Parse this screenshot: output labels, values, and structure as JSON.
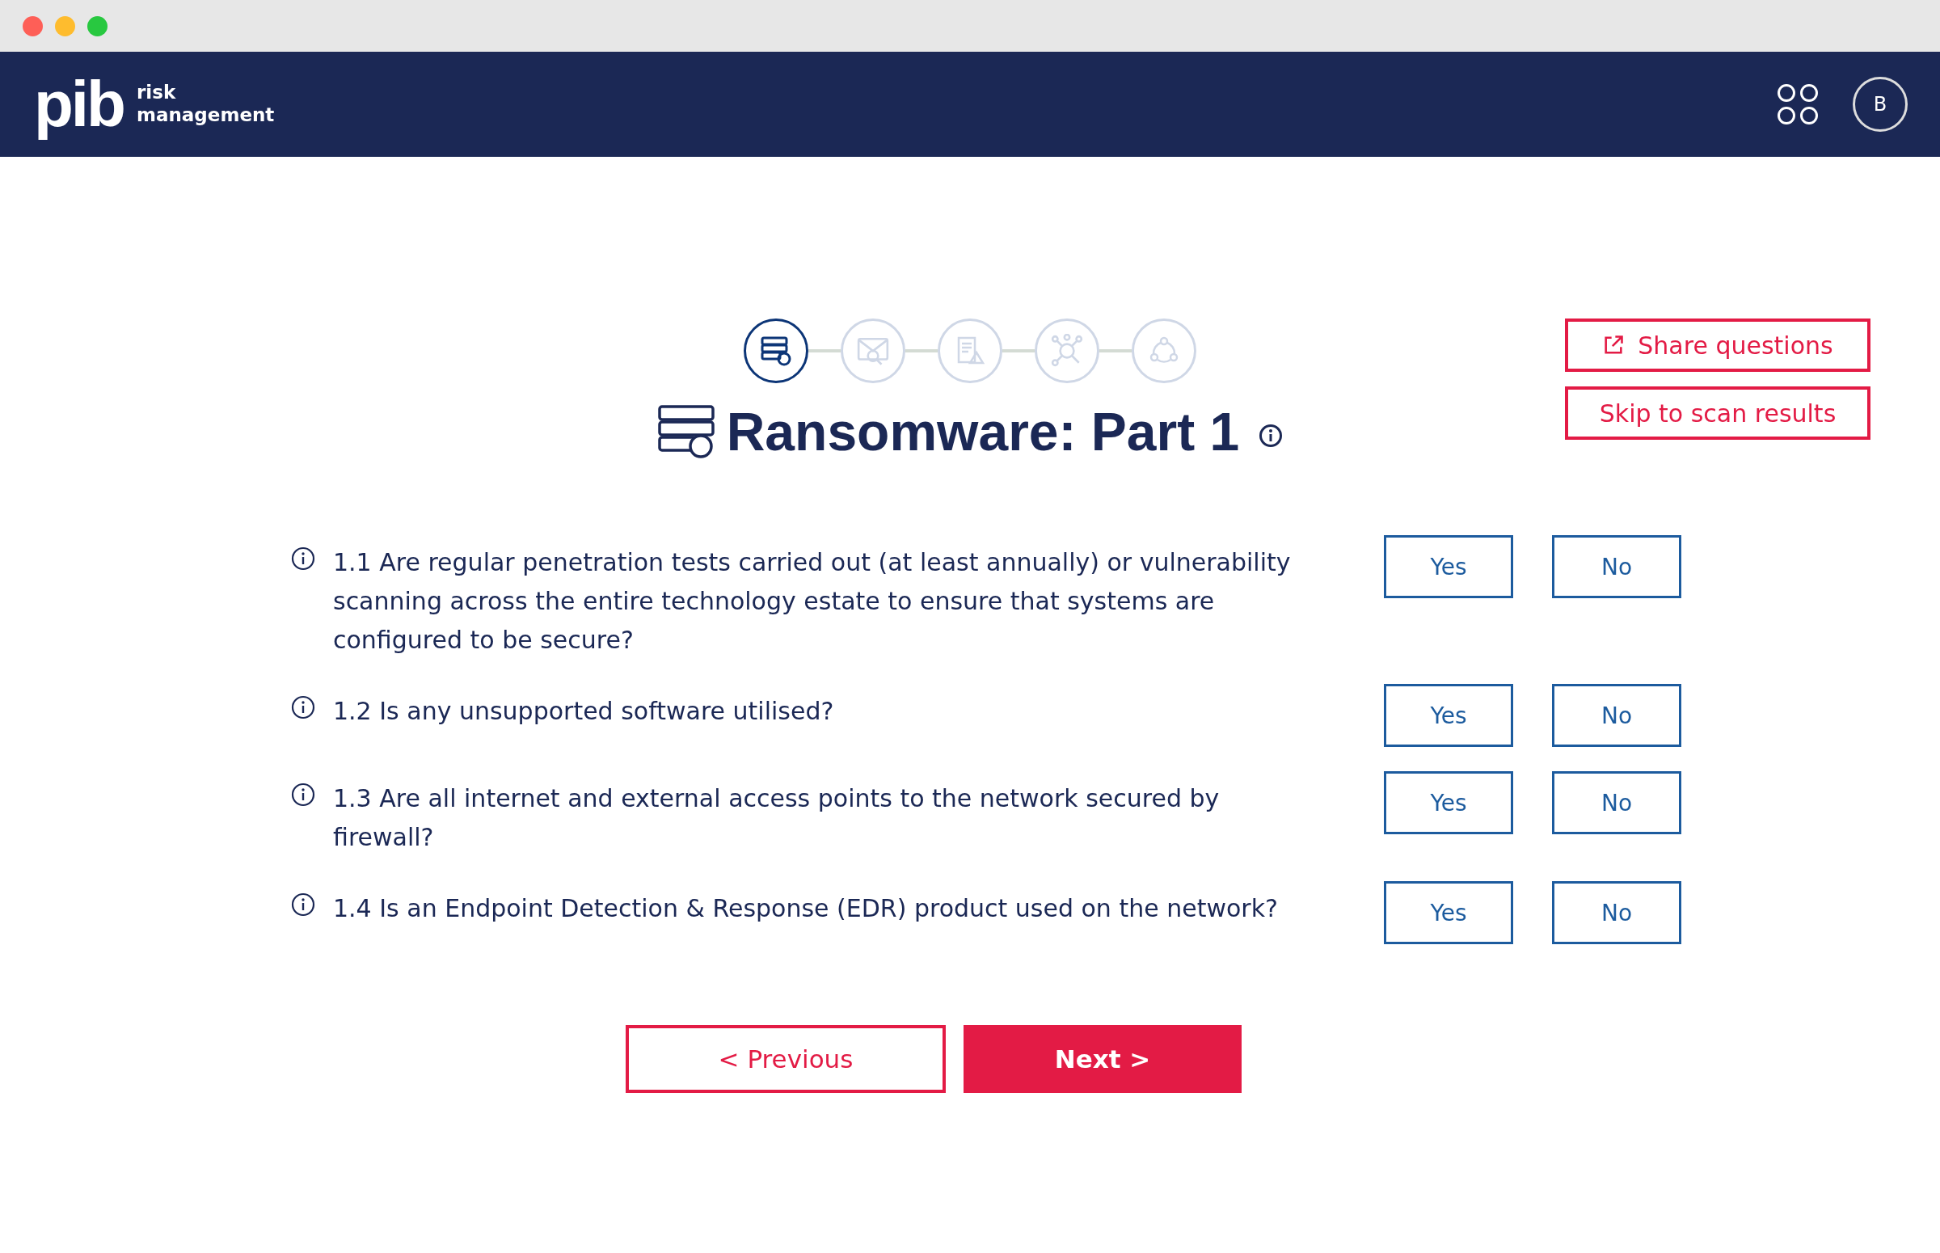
{
  "header": {
    "logo": "pib",
    "logo_subtitle_1": "risk",
    "logo_subtitle_2": "management",
    "avatar": "B"
  },
  "steps": [
    {
      "kind": "server",
      "selected": true
    },
    {
      "kind": "mail",
      "selected": false
    },
    {
      "kind": "document",
      "selected": false
    },
    {
      "kind": "network",
      "selected": false
    },
    {
      "kind": "cycle",
      "selected": false
    }
  ],
  "title": "Ransomware: Part 1",
  "actions": [
    {
      "kind": "share",
      "label": "Share questions"
    },
    {
      "kind": "plain",
      "label": "Skip to scan results"
    }
  ],
  "questions": [
    {
      "text": "1.1 Are regular penetration tests carried out (at least annually) or vulnerability scanning across the entire technology estate to ensure that systems are configured to be secure?",
      "answers": [
        "Yes",
        "No"
      ]
    },
    {
      "text": "1.2 Is any unsupported software utilised?",
      "answers": [
        "Yes",
        "No"
      ]
    },
    {
      "text": "1.3 Are all internet and external access points to the network secured by firewall?",
      "answers": [
        "Yes",
        "No"
      ]
    },
    {
      "text": "1.4 Is an Endpoint Detection & Response (EDR) product used on the network?",
      "answers": [
        "Yes",
        "No"
      ]
    }
  ],
  "nav": {
    "previous": "< Previous",
    "next": "Next >"
  }
}
